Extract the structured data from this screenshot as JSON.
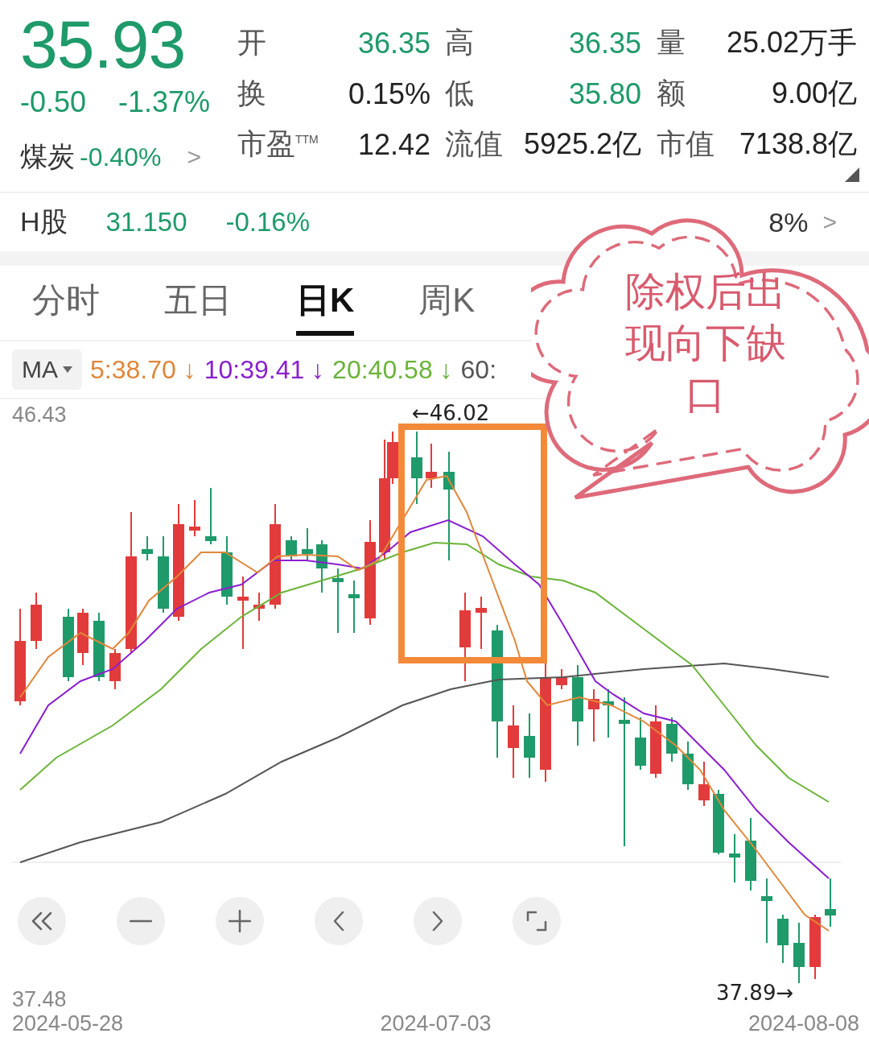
{
  "quote": {
    "price": "35.93",
    "change": "-0.50",
    "change_pct": "-1.37%",
    "sector": {
      "name": "煤炭",
      "change": "-0.40%",
      "arrow": ">"
    }
  },
  "stats": [
    {
      "label": "开",
      "value": "36.35",
      "color": "#1f9a6a"
    },
    {
      "label": "高",
      "value": "36.35",
      "color": "#1f9a6a"
    },
    {
      "label": "量",
      "value": "25.02万手",
      "color": "#222222"
    },
    {
      "label": "换",
      "value": "0.15%",
      "color": "#222222"
    },
    {
      "label": "低",
      "value": "35.80",
      "color": "#1f9a6a"
    },
    {
      "label": "额",
      "value": "9.00亿",
      "color": "#222222"
    },
    {
      "label": "市盈$^{TTM}$",
      "value": "12.42",
      "color": "#222222"
    },
    {
      "label": "流值",
      "value": "5925.2亿",
      "color": "#222222"
    },
    {
      "label": "市值",
      "value": "7138.8亿",
      "color": "#222222"
    }
  ],
  "h_share": {
    "label": "H股",
    "price": "31.150",
    "change": "-0.16%",
    "premium": "8%",
    "arrow": ">"
  },
  "tabs": [
    {
      "label": "分时",
      "selected": false
    },
    {
      "label": "五日",
      "selected": false
    },
    {
      "label": "日K",
      "selected": true
    },
    {
      "label": "周K",
      "selected": false
    }
  ],
  "indicator": {
    "button": "MA",
    "lines": [
      {
        "label": "5:38.70",
        "arrow": "↓",
        "color": "#e0873a"
      },
      {
        "label": "10:39.41",
        "arrow": "↓",
        "color": "#8a1fd0"
      },
      {
        "label": "20:40.58",
        "arrow": "↓",
        "color": "#6bb43a"
      },
      {
        "label": "60:",
        "color": "#555555"
      }
    ]
  },
  "chart": {
    "y_max": "46.43",
    "y_min": "37.48",
    "high_marker": "←46.02",
    "low_marker": "37.89→",
    "dates": [
      "2024-05-28",
      "2024-07-03",
      "2024-08-08"
    ]
  },
  "controls": [
    {
      "kind": "rewind"
    },
    {
      "kind": "zoom-out"
    },
    {
      "kind": "zoom-in"
    },
    {
      "kind": "prev"
    },
    {
      "kind": "next"
    },
    {
      "kind": "fullscreen"
    }
  ],
  "annotation": {
    "text": "除权后出现向下缺口"
  }
}
